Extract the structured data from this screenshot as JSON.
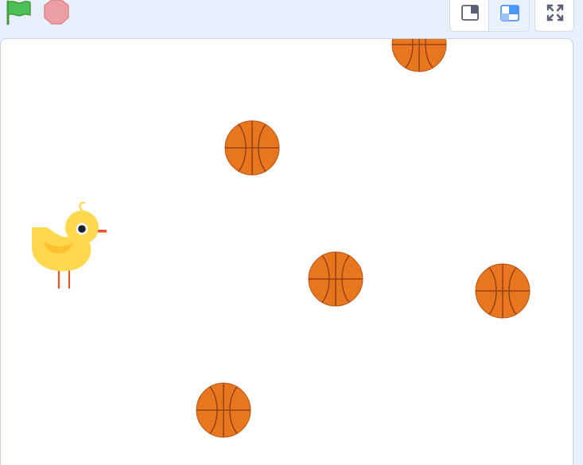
{
  "controls": {
    "green_flag_icon": "green-flag-icon",
    "stop_icon": "stop-sign-icon"
  },
  "layout_buttons": {
    "small_stage_icon": "small-stage-layout-icon",
    "normal_stage_icon": "normal-stage-layout-icon",
    "fullscreen_icon": "fullscreen-icon"
  },
  "stage": {
    "sprites": [
      {
        "name": "chick",
        "icon": "chick-sprite"
      },
      {
        "name": "basketball",
        "icon": "basketball-sprite"
      },
      {
        "name": "basketball",
        "icon": "basketball-sprite"
      },
      {
        "name": "basketball",
        "icon": "basketball-sprite"
      },
      {
        "name": "basketball",
        "icon": "basketball-sprite"
      },
      {
        "name": "basketball",
        "icon": "basketball-sprite"
      }
    ]
  },
  "colors": {
    "flag_green": "#4cbf56",
    "stop_red": "#ec9ea5",
    "ball_orange": "#e8761f",
    "ball_line": "#8a3b12",
    "chick_yellow": "#ffd84d",
    "chick_wing": "#ffbf2e",
    "chick_beak": "#e8532b",
    "selected_blue": "#4c97ff"
  }
}
